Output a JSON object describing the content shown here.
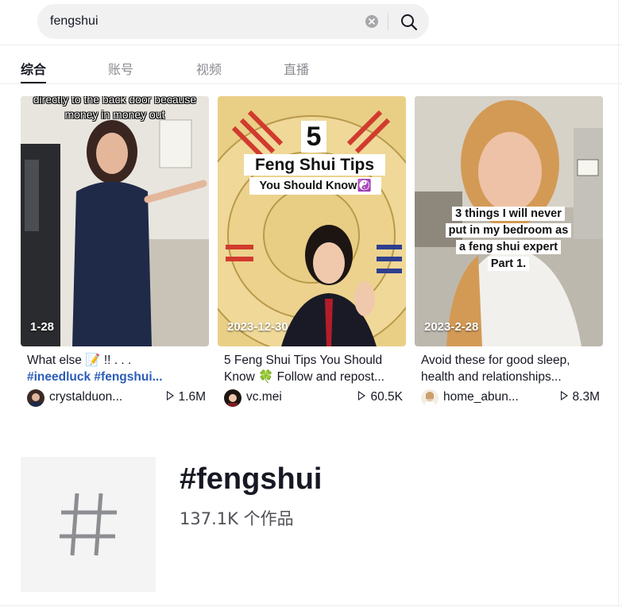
{
  "search": {
    "query": "fengshui"
  },
  "tabs": [
    {
      "label": "综合",
      "active": true
    },
    {
      "label": "账号",
      "active": false
    },
    {
      "label": "视频",
      "active": false
    },
    {
      "label": "直播",
      "active": false
    }
  ],
  "videos": [
    {
      "date": "1-28",
      "overlay_text": "directly to the back door because money in money out",
      "desc_text": "What else 📝 !! . . .",
      "desc_tags": "#ineedluck #fengshui...",
      "author": "crystalduon...",
      "plays": "1.6M"
    },
    {
      "date": "2023-12-30",
      "overlay_number": "5",
      "overlay_title": "Feng Shui Tips",
      "overlay_sub": "You Should Know☯️",
      "desc_text": "5 Feng Shui Tips You Should Know 🍀 Follow and repost...",
      "author": "vc.mei",
      "plays": "60.5K"
    },
    {
      "date": "2023-2-28",
      "overlay_lines": [
        "3 things I will never",
        "put in my bedroom as",
        "a feng shui expert",
        "Part 1."
      ],
      "desc_text": "Avoid these for good sleep, health and relationships...",
      "author": "home_abun...",
      "plays": "8.3M"
    }
  ],
  "hashtag": {
    "title": "#fengshui",
    "count": "137.1K 个作品"
  },
  "colors": {
    "accent_tag": "#2b5db9",
    "text": "#161823",
    "muted": "#8a8b91"
  }
}
